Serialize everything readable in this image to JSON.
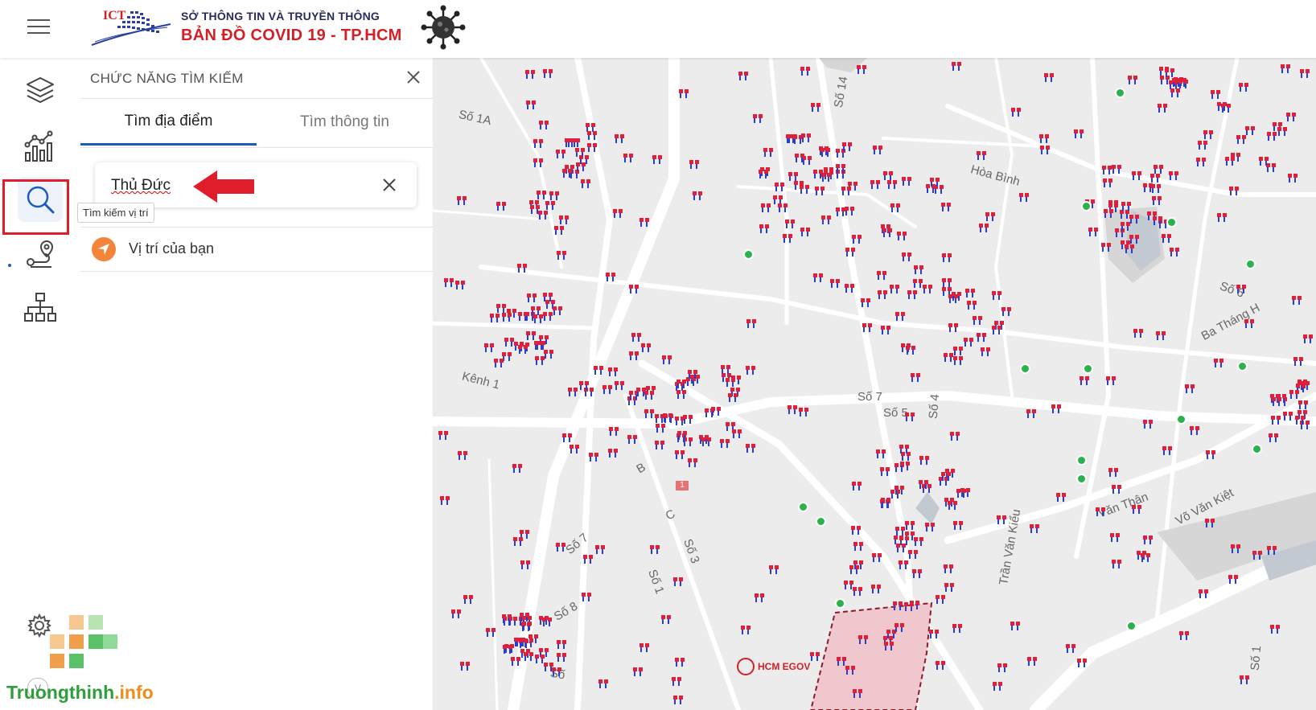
{
  "header": {
    "menu_icon": "hamburger-icon",
    "org_name": "SỞ THÔNG TIN VÀ TRUYỀN THÔNG",
    "app_title": "BẢN ĐỒ  COVID 19 - TP.HCM",
    "logo_text": "ICT"
  },
  "rail": {
    "items": [
      {
        "icon": "layers-icon",
        "label": "layers"
      },
      {
        "icon": "chart-icon",
        "label": "statistics"
      },
      {
        "icon": "search-icon",
        "label": "search",
        "active": true
      },
      {
        "icon": "route-icon",
        "label": "directions"
      },
      {
        "icon": "sitemap-icon",
        "label": "organization"
      }
    ],
    "tooltip": "Tìm kiếm vị trí",
    "settings_icon": "gear-icon"
  },
  "panel": {
    "title": "CHỨC NĂNG TÌM KIẾM",
    "close_icon": "close-icon",
    "tabs": [
      {
        "label": "Tìm địa điểm",
        "active": true
      },
      {
        "label": "Tìm thông tin",
        "active": false
      }
    ],
    "search": {
      "value": "Thủ Đức",
      "placeholder": ""
    },
    "my_location_label": "Vị trí của bạn"
  },
  "map": {
    "labels": [
      "Số 1A",
      "Số 14",
      "Hòa Bình",
      "Kênh 1",
      "Số 7",
      "Số 5",
      "Số 4",
      "Số 6",
      "Ba Tháng H",
      "Văn Thân",
      "Võ Văn Kiệt",
      "Trần Văn Kiểu",
      "Số 7",
      "Số 3",
      "Số 1",
      "Số 8",
      "B",
      "C",
      "Số",
      "Số 1"
    ],
    "road_marker": "1",
    "egov_label": "HCM EGOV"
  },
  "watermark": {
    "brand_green": "Truongthinh",
    "brand_orange": ".info"
  },
  "colors": {
    "accent": "#1e5bbf",
    "title_red": "#d32027",
    "poi_blue": "#2a3fd0",
    "poi_red": "#e0203a",
    "highlight_red": "#e01e2b"
  }
}
